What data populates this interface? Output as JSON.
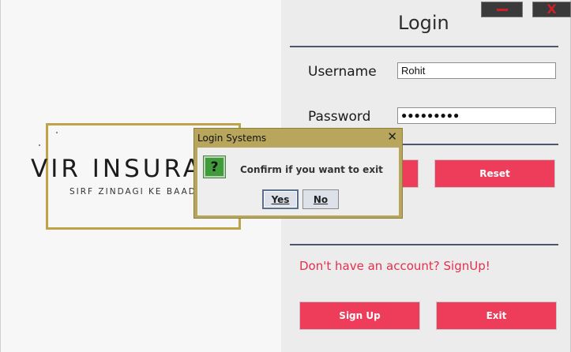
{
  "window": {
    "minimize_icon": "minimize-icon",
    "close_glyph": "X"
  },
  "brand": {
    "title": "VIR INSURA",
    "tagline": "SIRF ZINDAGI KE BAAD"
  },
  "login": {
    "heading": "Login",
    "username_label": "Username",
    "username_value": "Rohit",
    "password_label": "Password",
    "password_value": "●●●●●●●●●",
    "reset_label": "Reset",
    "signup_prompt": "Don't have an account? SignUp!",
    "signup_label": "Sign Up",
    "exit_label": "Exit"
  },
  "dialog": {
    "title": "Login Systems",
    "close_glyph": "✕",
    "icon_glyph": "?",
    "message": "Confirm if you want to exit",
    "yes_label": "Yes",
    "no_label": "No"
  },
  "colors": {
    "accent": "#ee3d5a",
    "brand_gold": "#bfa24a",
    "separator": "#4d5670",
    "dialog_frame": "#b7a65b"
  }
}
